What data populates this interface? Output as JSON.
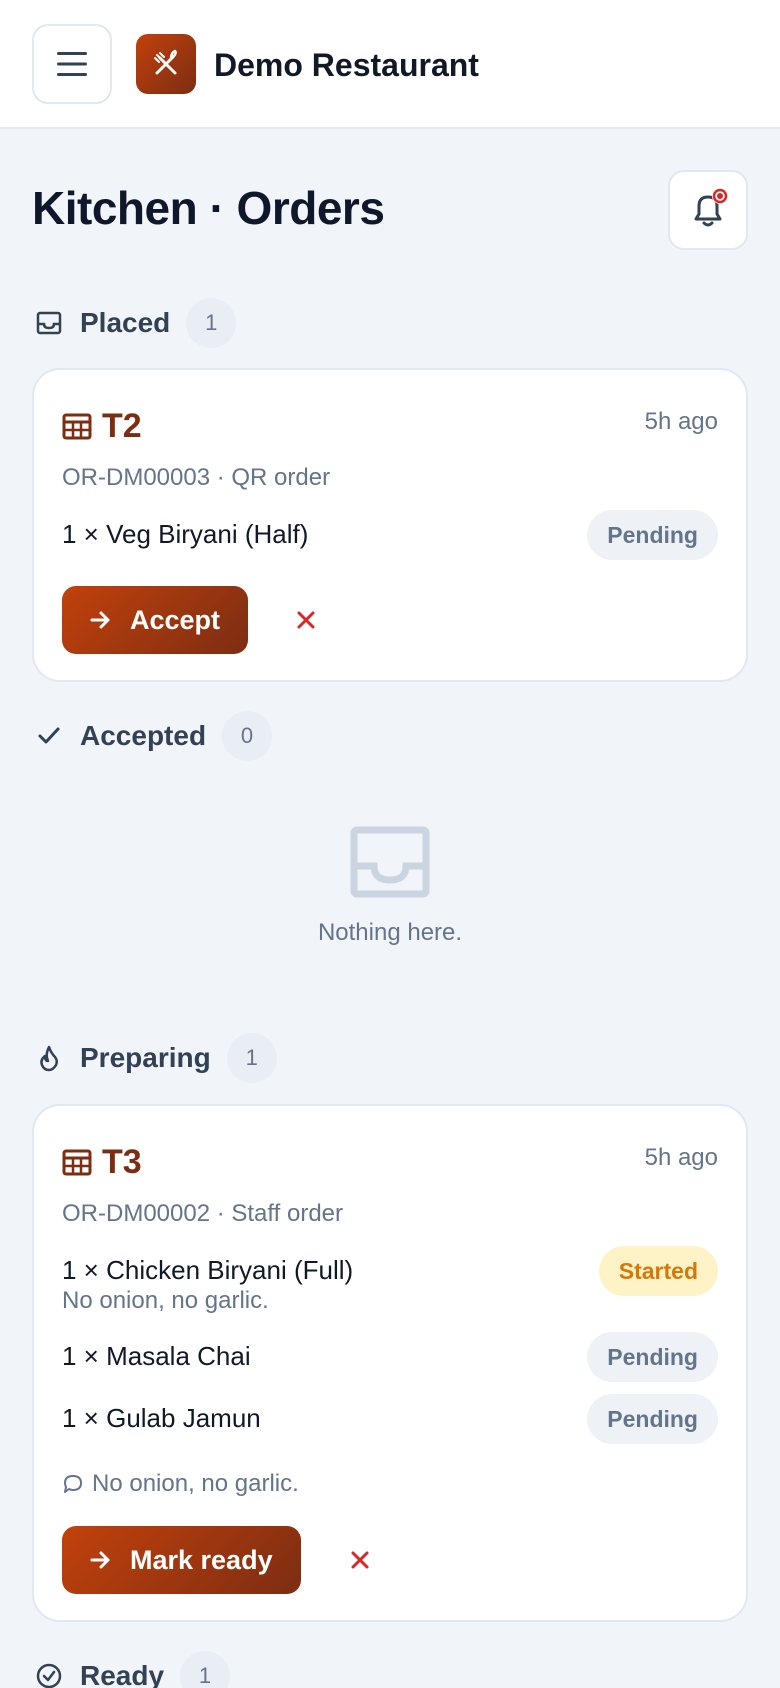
{
  "header": {
    "brand": "Demo Restaurant",
    "menu_icon": "hamburger-icon",
    "logo_icon": "utensils-icon"
  },
  "page": {
    "title": "Kitchen · Orders",
    "notification_icon": "bell-icon"
  },
  "sections": {
    "placed": {
      "title": "Placed",
      "count": "1",
      "icon": "inbox-icon"
    },
    "accepted": {
      "title": "Accepted",
      "count": "0",
      "icon": "check-icon",
      "empty_text": "Nothing here."
    },
    "preparing": {
      "title": "Preparing",
      "count": "1",
      "icon": "flame-icon"
    },
    "ready": {
      "title": "Ready",
      "count": "1",
      "icon": "check-circle-icon"
    }
  },
  "orders": [
    {
      "table": "T2",
      "ago": "5h ago",
      "meta": "OR-DM00003 · QR order",
      "items": [
        {
          "name": "1 × Veg Biryani (Half)",
          "note": "",
          "status": "Pending"
        }
      ],
      "order_note": "",
      "action_label": "Accept"
    },
    {
      "table": "T3",
      "ago": "5h ago",
      "meta": "OR-DM00002 · Staff order",
      "items": [
        {
          "name": "1 × Chicken Biryani (Full)",
          "note": "No onion, no garlic.",
          "status": "Started"
        },
        {
          "name": "1 × Masala Chai",
          "note": "",
          "status": "Pending"
        },
        {
          "name": "1 × Gulab Jamun",
          "note": "",
          "status": "Pending"
        }
      ],
      "order_note": "No onion, no garlic.",
      "action_label": "Mark ready"
    }
  ],
  "colors": {
    "brand_gradient_start": "#c2410c",
    "brand_gradient_end": "#7c2d12",
    "cancel": "#dc2626",
    "notification_dot": "#dc2626"
  }
}
